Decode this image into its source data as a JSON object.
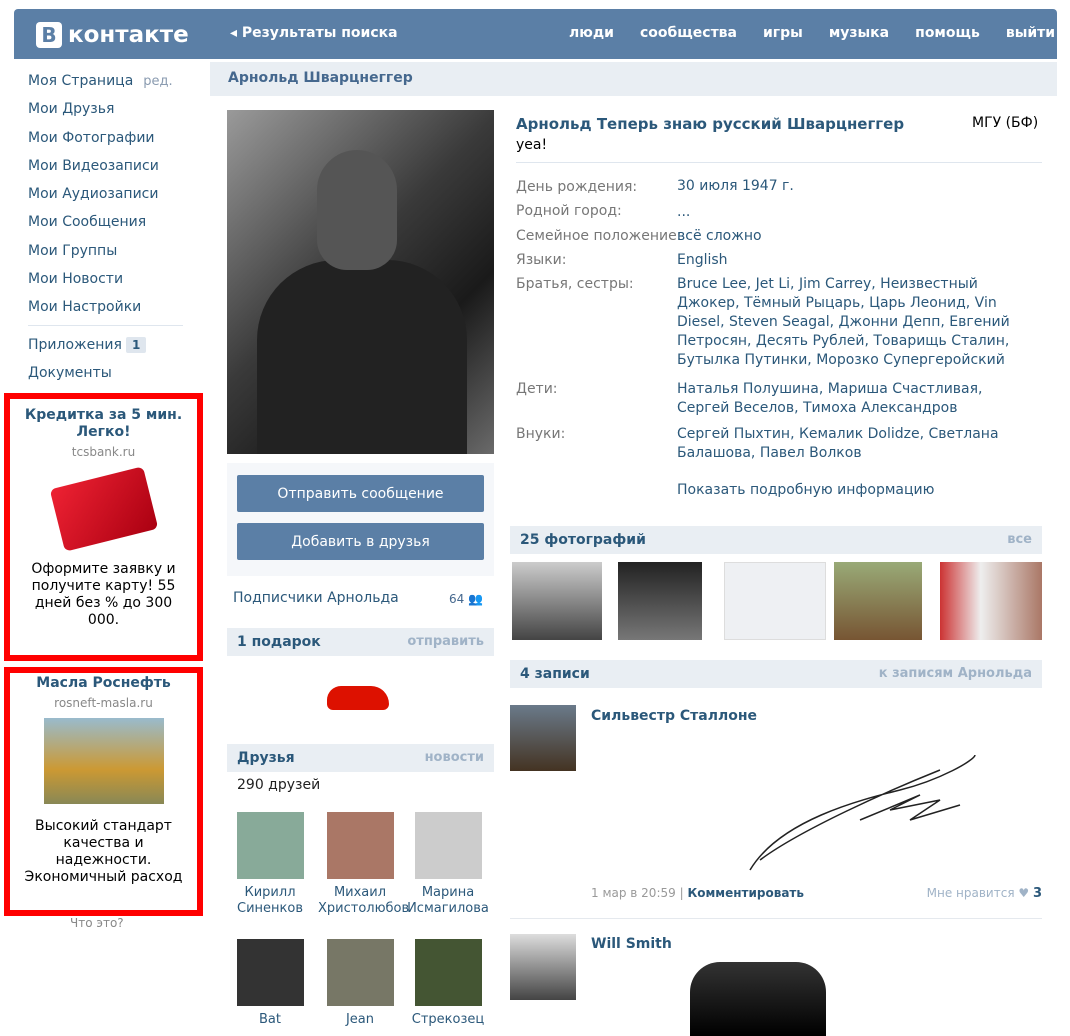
{
  "header": {
    "logo_letter": "В",
    "logo_text": "контакте",
    "back_label": "◂ Результаты поиска",
    "nav": [
      "люди",
      "сообщества",
      "игры",
      "музыка",
      "помощь",
      "выйти"
    ]
  },
  "sidebar": {
    "my_page": "Моя Страница",
    "edit": "ред.",
    "items": [
      "Мои Друзья",
      "Мои Фотографии",
      "Мои Видеозаписи",
      "Мои Аудиозаписи",
      "Мои Сообщения",
      "Мои Группы",
      "Мои Новости",
      "Мои Настройки"
    ],
    "apps": "Приложения",
    "apps_badge": "1",
    "docs": "Документы"
  },
  "ads": [
    {
      "title": "Кредитка за 5 мин. Легко!",
      "domain": "tcsbank.ru",
      "text": "Оформите заявку и получите карту! 55 дней без % до 300 000."
    },
    {
      "title": "Масла Роснефть",
      "domain": "rosneft-masla.ru",
      "text": "Высокий стандарт качества и надежности. Экономичный расход"
    }
  ],
  "ads_what": "Что это?",
  "profile": {
    "page_title": "Арнольд Шварцнеггер",
    "full_name": "Арнольд Теперь знаю русский Шварцнеггер",
    "status": "yea!",
    "university": "МГУ (БФ)",
    "fields": [
      {
        "label": "День рождения:",
        "value": "30 июля 1947 г."
      },
      {
        "label": "Родной город:",
        "value": "..."
      },
      {
        "label": "Семейное положение:",
        "value": "всё сложно"
      },
      {
        "label": "Языки:",
        "value": "English"
      },
      {
        "label": "Братья, сестры:",
        "value": "Bruce Lee, Jet Li, Jim Carrey, Неизвестный Джокер, Тёмный Рыцарь, Царь Леонид, Vin Diesel, Steven Seagal, Джонни Депп, Евгений Петросян, Десять Рублей, Товарищь Сталин, Бутылка Путинки, Морозко Супергеройский"
      },
      {
        "label": "Дети:",
        "value": "Наталья Полушина, Мариша Счастливая, Сергей Веселов, Тимоха Александров"
      },
      {
        "label": "Внуки:",
        "value": "Сергей Пыхтин, Кемалик Dolidze, Светлана Балашова, Павел Волков"
      }
    ],
    "show_more": "Показать подробную информацию"
  },
  "actions": {
    "send_message": "Отправить сообщение",
    "add_friend": "Добавить в друзья"
  },
  "subscribers": {
    "label": "Подписчики Арнольда",
    "count": "64"
  },
  "gifts": {
    "title": "1 подарок",
    "action": "отправить"
  },
  "friends": {
    "title": "Друзья",
    "action": "новости",
    "count_text": "290 друзей",
    "list": [
      {
        "first": "Кирилл",
        "last": "Синенков"
      },
      {
        "first": "Михаил",
        "last": "Христолюбов"
      },
      {
        "first": "Марина",
        "last": "Исмагилова"
      },
      {
        "first": "Bat",
        "last": ""
      },
      {
        "first": "Jean",
        "last": ""
      },
      {
        "first": "Стрекозец",
        "last": ""
      }
    ]
  },
  "photos": {
    "title": "25 фотографий",
    "action": "все"
  },
  "wall": {
    "title": "4 записи",
    "action": "к записям Арнольда",
    "posts": [
      {
        "author": "Сильвестр Сталлоне",
        "date": "1 мар в 20:59",
        "comment": "Комментировать",
        "like_label": "Мне нравится",
        "likes": "3"
      },
      {
        "author": "Will Smith"
      }
    ]
  }
}
